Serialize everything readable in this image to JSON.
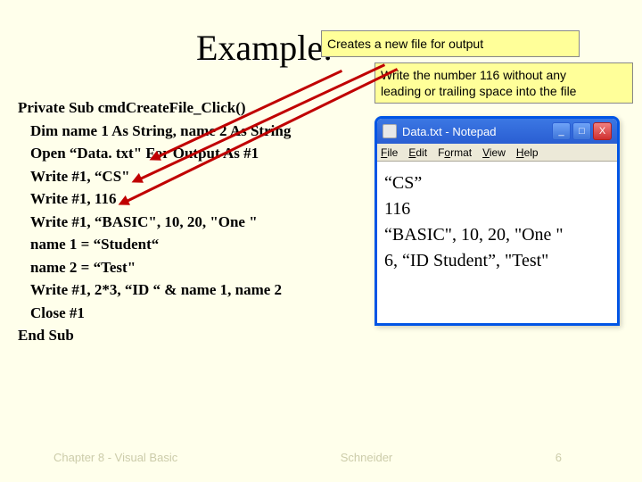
{
  "title": "Example:",
  "callout_small": "Creates a new  file for output",
  "callout_tail": "bounded",
  "callout_large_line1": "Write the number 116 without any",
  "callout_large_line2": "leading or trailing space into the file",
  "code": {
    "l1": "Private Sub cmdCreateFile_Click()",
    "l2": "Dim name 1 As String, name 2 As String",
    "l3": "Open “Data. txt\" For Output As #1",
    "l4": "Write #1, “CS\"",
    "l5": "Write #1, 116",
    "l6": "Write #1, “BASIC\", 10, 20, \"One \"",
    "l7": "name 1 = “Student“",
    "l8": "name 2 = “Test\"",
    "l9": "Write #1, 2*3, “ID “ & name 1, name 2",
    "l10": "Close #1",
    "l11": "End Sub"
  },
  "notepad": {
    "title": "Data.txt - Notepad",
    "menu": {
      "file": "File",
      "edit": "Edit",
      "format": "Format",
      "view": "View",
      "help": "Help"
    },
    "body": {
      "l1": "“CS”",
      "l2": "116",
      "l3": "“BASIC\", 10, 20, \"One \"",
      "l4": "6, “ID Student”, \"Test\""
    },
    "btn_min": "_",
    "btn_max": "□",
    "btn_close": "X"
  },
  "footer": {
    "left": "Chapter 8 - Visual Basic",
    "center": "Schneider",
    "page": "6"
  }
}
